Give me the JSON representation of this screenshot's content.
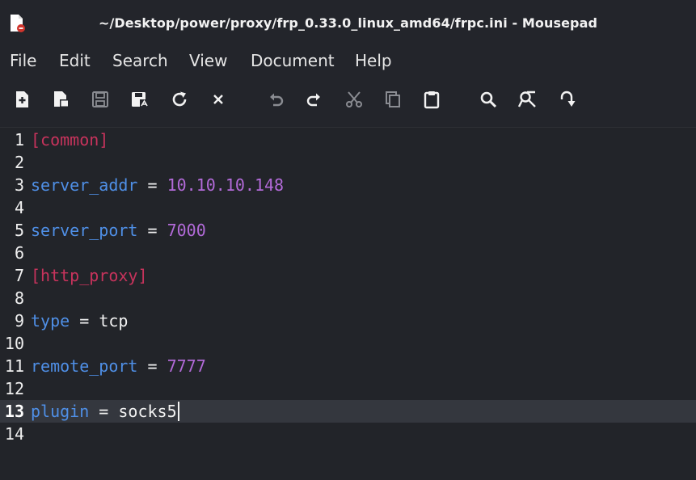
{
  "window": {
    "title": "~/Desktop/power/proxy/frp_0.33.0_linux_amd64/frpc.ini - Mousepad"
  },
  "menu": {
    "items": [
      "File",
      "Edit",
      "Search",
      "View",
      "Document",
      "Help"
    ]
  },
  "toolbar": {
    "icons": [
      "new-document-icon",
      "open-document-icon",
      "save-icon",
      "save-as-icon",
      "reload-icon",
      "close-icon",
      "undo-icon",
      "redo-icon",
      "cut-icon",
      "copy-icon",
      "paste-icon",
      "find-icon",
      "find-replace-icon",
      "go-to-line-icon"
    ]
  },
  "editor": {
    "current_line": 13,
    "lines": [
      {
        "n": "1",
        "section": "[common]"
      },
      {
        "n": "2"
      },
      {
        "n": "3",
        "key": "server_addr",
        "op": "=",
        "value": "10.10.10.148",
        "numeric": true
      },
      {
        "n": "4"
      },
      {
        "n": "5",
        "key": "server_port",
        "op": "=",
        "value": "7000",
        "numeric": true
      },
      {
        "n": "6"
      },
      {
        "n": "7",
        "section": "[http_proxy]"
      },
      {
        "n": "8"
      },
      {
        "n": "9",
        "key": "type",
        "op": "=",
        "value": "tcp",
        "numeric": false
      },
      {
        "n": "10"
      },
      {
        "n": "11",
        "key": "remote_port",
        "op": "=",
        "value": "7777",
        "numeric": true
      },
      {
        "n": "12"
      },
      {
        "n": "13",
        "key": "plugin",
        "op": "=",
        "value": "socks5",
        "numeric": false
      },
      {
        "n": "14"
      }
    ]
  },
  "colors": {
    "background": "#222429",
    "current_line": "#34373e",
    "section": "#c7335c",
    "key": "#4f8fe6",
    "number": "#b26ad8",
    "text": "#f2f2f2",
    "app_icon_accent": "#d0342c"
  }
}
